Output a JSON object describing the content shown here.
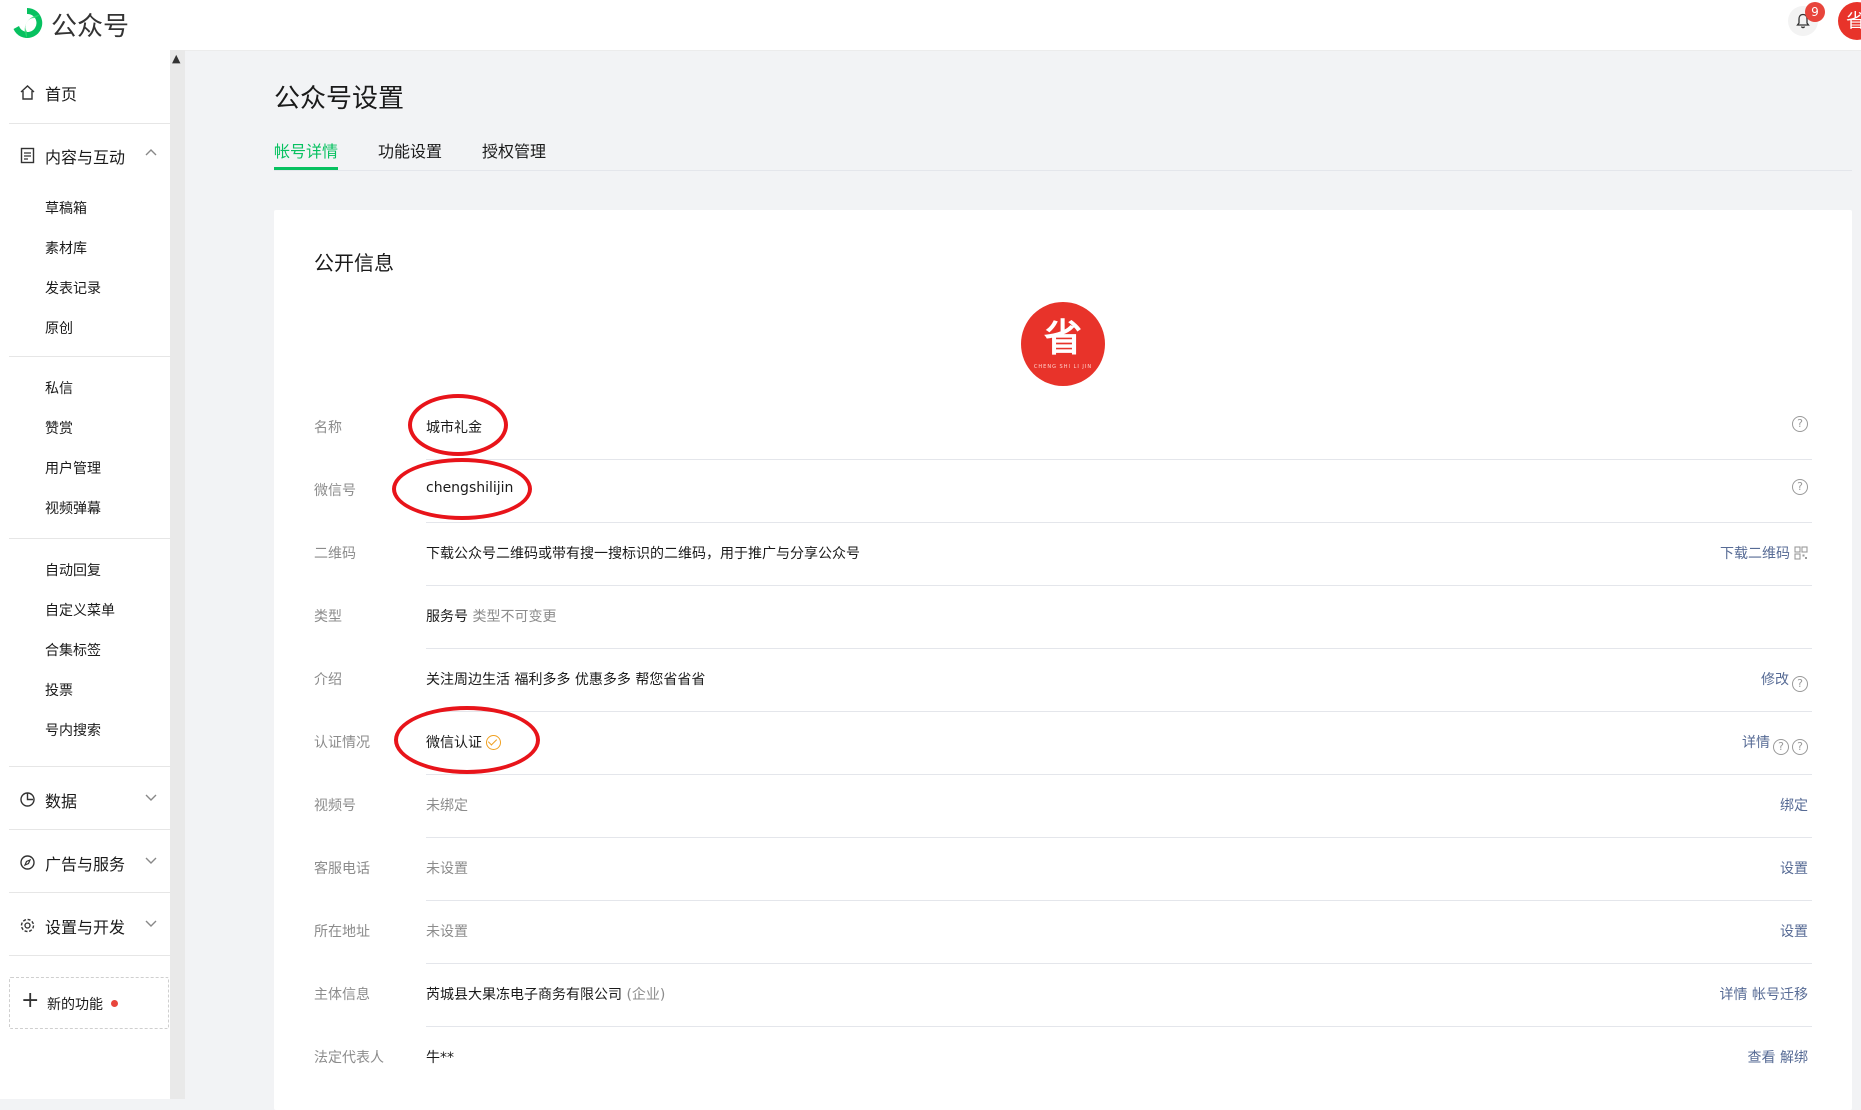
{
  "app": {
    "brand": "公众号",
    "notification_count": "9",
    "avatar_char": "省"
  },
  "sidebar": {
    "home": "首页",
    "content_group": "内容与互动",
    "content_items": [
      "草稿箱",
      "素材库",
      "发表记录",
      "原创"
    ],
    "interact_items": [
      "私信",
      "赞赏",
      "用户管理",
      "视频弹幕"
    ],
    "feature_items": [
      "自动回复",
      "自定义菜单",
      "合集标签",
      "投票",
      "号内搜索"
    ],
    "data": "数据",
    "ads": "广告与服务",
    "settings": "设置与开发",
    "new_features": "新的功能"
  },
  "page": {
    "title": "公众号设置",
    "tabs": [
      "帐号详情",
      "功能设置",
      "授权管理"
    ],
    "active_tab": "帐号详情"
  },
  "card": {
    "title": "公开信息",
    "avatar_char": "省",
    "avatar_subtext": "CHENG SHI LI JIN"
  },
  "rows": {
    "name": {
      "label": "名称",
      "value": "城市礼金"
    },
    "wechat_id": {
      "label": "微信号",
      "value": "chengshilijin"
    },
    "qrcode": {
      "label": "二维码",
      "value": "下载公众号二维码或带有搜一搜标识的二维码，用于推广与分享公众号",
      "action": "下载二维码"
    },
    "type": {
      "label": "类型",
      "value": "服务号",
      "note": "类型不可变更"
    },
    "intro": {
      "label": "介绍",
      "value": "关注周边生活 福利多多 优惠多多 帮您省省省",
      "action": "修改"
    },
    "verify": {
      "label": "认证情况",
      "value": "微信认证",
      "action": "详情"
    },
    "channels": {
      "label": "视频号",
      "value": "未绑定",
      "action": "绑定"
    },
    "phone": {
      "label": "客服电话",
      "value": "未设置",
      "action": "设置"
    },
    "address": {
      "label": "所在地址",
      "value": "未设置",
      "action": "设置"
    },
    "entity": {
      "label": "主体信息",
      "value": "芮城县大果冻电子商务有限公司",
      "note": "(企业)",
      "action1": "详情",
      "action2": "帐号迁移"
    },
    "legal": {
      "label": "法定代表人",
      "value": "牛**",
      "action1": "查看",
      "action2": "解绑"
    }
  },
  "colors": {
    "accent": "#07c160",
    "link": "#576b95",
    "annotation": "#e8141a",
    "badge": "#e8453c"
  }
}
